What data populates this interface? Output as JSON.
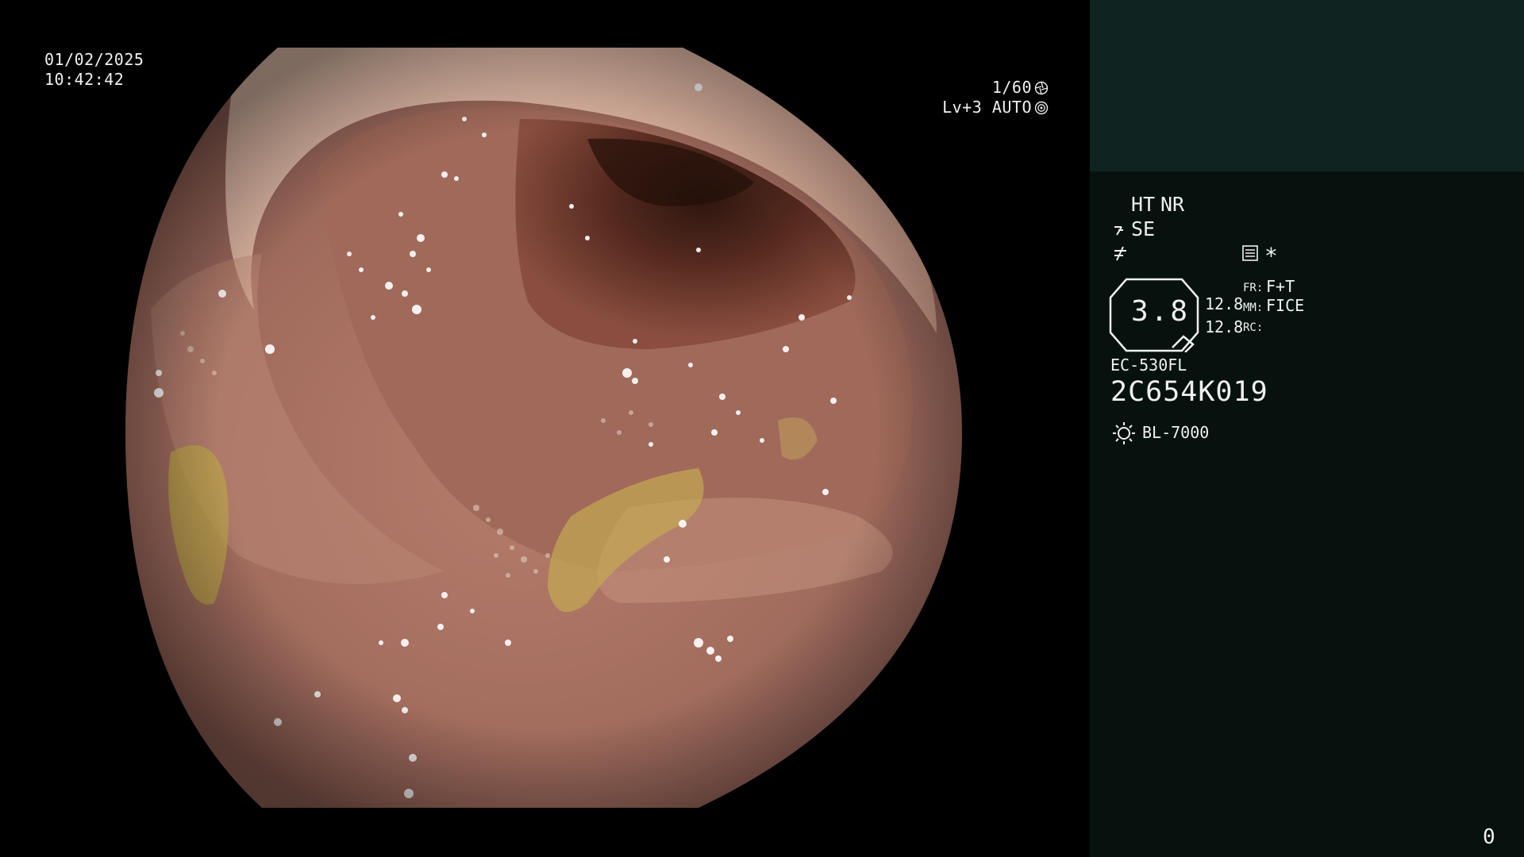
{
  "overlay": {
    "date": "01/02/2025",
    "time": "10:42:42",
    "shutter": "1/60",
    "exposure": "Lv+3 AUTO"
  },
  "panel": {
    "mode_ht": "HT",
    "mode_nr": "NR",
    "mode_se": "SE",
    "zoom_value": "3.8",
    "value_1": "12.8",
    "value_2": "12.8",
    "fr_label": "FR:",
    "fr_value": "F+T",
    "mm_label": "MM:",
    "mm_value": "FICE",
    "rc_label": "RC:",
    "rc_value": "",
    "star": "*",
    "scope_model": "EC-530FL",
    "scope_serial": "2C654K019",
    "light_source": "BL-7000",
    "counter": "0"
  },
  "colors": {
    "panel_top": "#0f2421",
    "panel_bottom": "#07120f",
    "ht_indicator": "#59e060",
    "text": "#f0f0f0"
  },
  "icons": [
    "shutter-icon",
    "iris-icon",
    "structure-enhancement-icon",
    "f-mode-icon",
    "menu-icon",
    "light-source-icon"
  ]
}
